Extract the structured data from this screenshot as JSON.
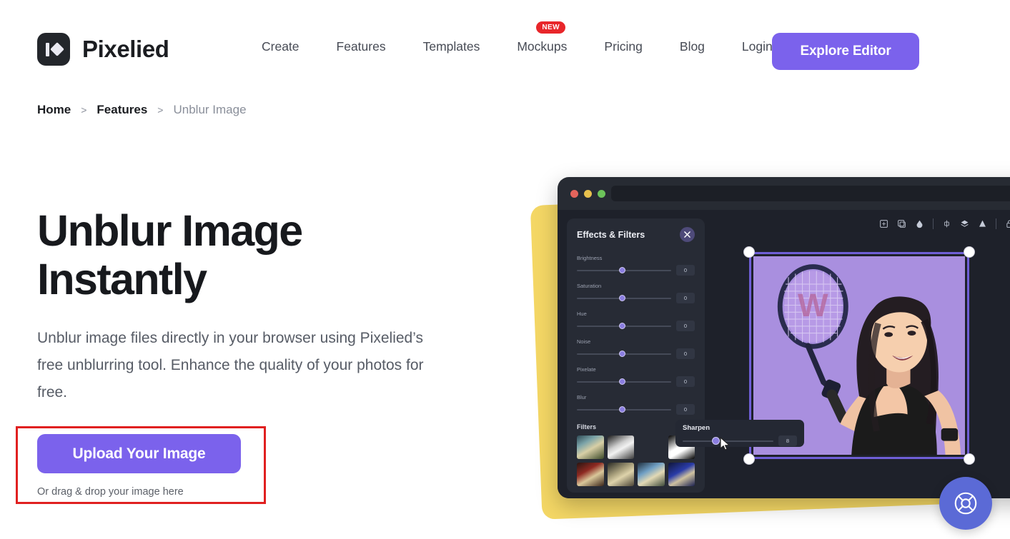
{
  "header": {
    "brand_name": "Pixelied",
    "nav_items": [
      {
        "label": "Create",
        "badge": ""
      },
      {
        "label": "Features",
        "badge": ""
      },
      {
        "label": "Templates",
        "badge": ""
      },
      {
        "label": "Mockups",
        "badge": "NEW"
      },
      {
        "label": "Pricing",
        "badge": ""
      },
      {
        "label": "Blog",
        "badge": ""
      },
      {
        "label": "Login",
        "badge": ""
      }
    ],
    "cta_label": "Explore Editor",
    "accent_color": "#7b62ec",
    "badge_color": "#e8262a"
  },
  "breadcrumb": {
    "home": "Home",
    "sep1": ">",
    "features": "Features",
    "sep2": ">",
    "current": "Unblur Image"
  },
  "hero": {
    "title_line1": "Unblur Image",
    "title_line2": "Instantly",
    "subtitle": "Unblur image files directly in your browser using Pixelied’s free unblurring tool. Enhance the quality of your photos for free.",
    "upload_label": "Upload Your Image",
    "drag_hint": "Or drag & drop your image here",
    "highlight_color": "#e02020"
  },
  "editor": {
    "panel_title": "Effects & Filters",
    "sliders": [
      {
        "label": "Brightness",
        "value": "0"
      },
      {
        "label": "Saturation",
        "value": "0"
      },
      {
        "label": "Hue",
        "value": "0"
      },
      {
        "label": "Noise",
        "value": "0"
      },
      {
        "label": "Pixelate",
        "value": "0"
      },
      {
        "label": "Blur",
        "value": "0"
      }
    ],
    "filters_title": "Filters",
    "filters": [
      {
        "name": "filter-cool"
      },
      {
        "name": "filter-grayscale"
      },
      {
        "name": "filter-sepia"
      },
      {
        "name": "filter-highcontrast"
      },
      {
        "name": "filter-warm-red"
      },
      {
        "name": "filter-vintage"
      },
      {
        "name": "filter-blue-tint"
      },
      {
        "name": "filter-deep-blue"
      }
    ],
    "toolbar_icons": [
      "crop-icon",
      "duplicate-frame-icon",
      "opacity-icon",
      "align-icon",
      "layers-icon",
      "contrast-icon",
      "lock-icon",
      "copy-icon",
      "trash-icon"
    ],
    "sharpen": {
      "label": "Sharpen",
      "value": "8"
    },
    "canvas_bg": "#a98fdf",
    "selection_color": "#6f5fd6",
    "accent_yellow": "#f4d765"
  },
  "support": {
    "icon": "lifebuoy-icon"
  }
}
